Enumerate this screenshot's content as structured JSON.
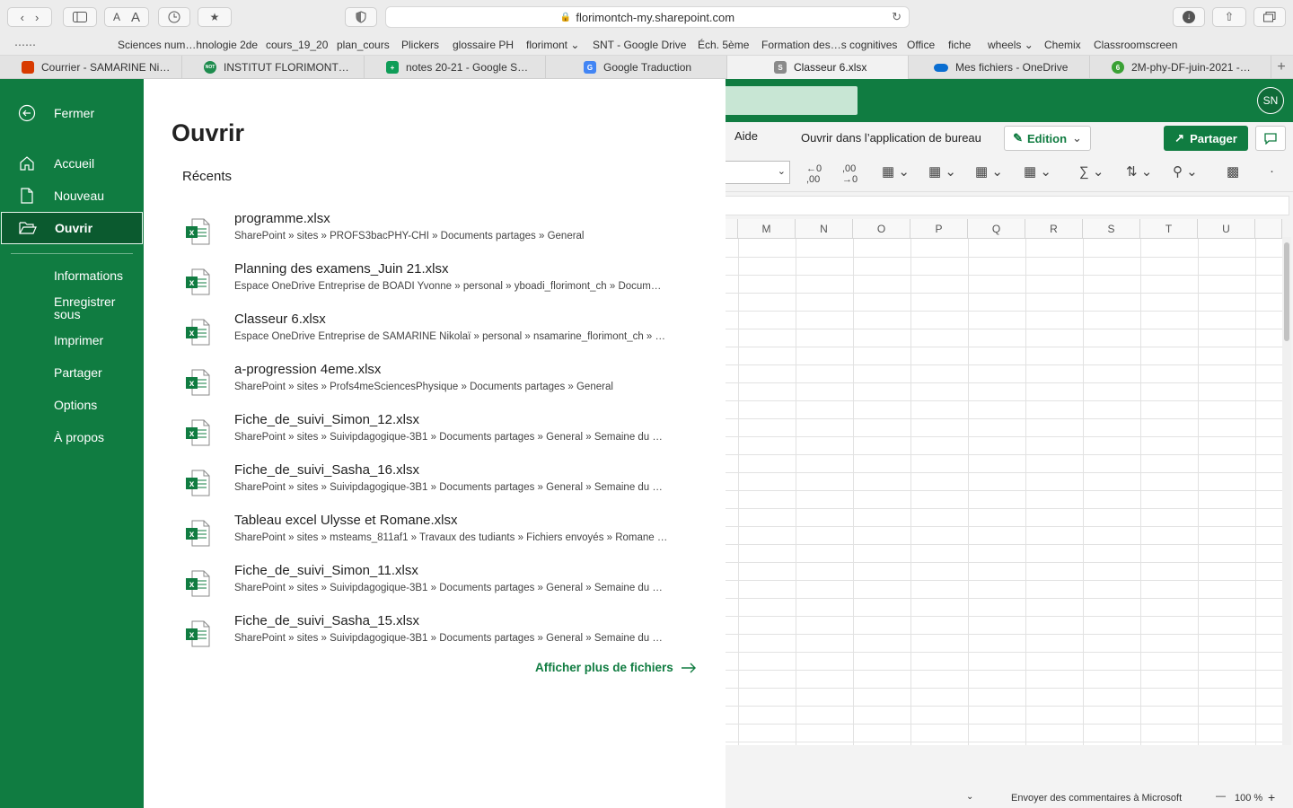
{
  "browser": {
    "url": "florimontch-my.sharepoint.com",
    "font_small": "A",
    "font_large": "A",
    "bookmarks": [
      {
        "label": "Sciences num…hnologie 2de"
      },
      {
        "label": "cours_19_20"
      },
      {
        "label": "plan_cours"
      },
      {
        "label": "Plickers"
      },
      {
        "label": "glossaire PH"
      },
      {
        "label": "florimont ⌄"
      },
      {
        "label": "SNT - Google Drive"
      },
      {
        "label": "Éch. 5ème"
      },
      {
        "label": "Formation des…s cognitives"
      },
      {
        "label": "Office"
      },
      {
        "label": "fiche"
      },
      {
        "label": "wheels ⌄"
      },
      {
        "label": "Chemix"
      },
      {
        "label": "Classroomscreen"
      }
    ],
    "tabs": [
      {
        "label": "Courrier - SAMARINE Ni…",
        "color": "#d83b01",
        "glyph": ""
      },
      {
        "label": "INSTITUT FLORIMONT…",
        "color": "#1e8c4e",
        "glyph": "NOT"
      },
      {
        "label": "notes 20-21 - Google S…",
        "color": "#0f9d58",
        "glyph": "+"
      },
      {
        "label": "Google Traduction",
        "color": "#4285f4",
        "glyph": "G"
      },
      {
        "label": "Classeur 6.xlsx",
        "color": "#8a8a8a",
        "glyph": "S"
      },
      {
        "label": "Mes fichiers - OneDrive",
        "color": "#0a6ed1",
        "glyph": ""
      },
      {
        "label": "2M-phy-DF-juin-2021 -…",
        "color": "#3aa135",
        "glyph": "6"
      }
    ]
  },
  "excel": {
    "avatar": "SN",
    "menu_aide": "Aide",
    "open_desktop": "Ouvrir dans l’application de bureau",
    "edition_label": "Edition",
    "share_label": "Partager",
    "columns": [
      "M",
      "N",
      "O",
      "P",
      "Q",
      "R",
      "S",
      "T",
      "U"
    ],
    "status_feedback": "Envoyer des commentaires à Microsoft",
    "zoom_minus": "—",
    "zoom_value": "100 %",
    "zoom_plus": "+",
    "accent": "#107c41"
  },
  "backstage": {
    "nav": {
      "close": "Fermer",
      "home": "Accueil",
      "new": "Nouveau",
      "open": "Ouvrir",
      "info": "Informations",
      "save_as_1": "Enregistrer",
      "save_as_2": "sous",
      "print": "Imprimer",
      "share": "Partager",
      "options": "Options",
      "about": "À propos"
    },
    "title": "Ouvrir",
    "recent_label": "Récents",
    "files": [
      {
        "name": "programme.xlsx",
        "path": "SharePoint » sites » PROFS3bacPHY-CHI » Documents partages » General"
      },
      {
        "name": "Planning des examens_Juin 21.xlsx",
        "path": "Espace OneDrive Entreprise de BOADI Yvonne » personal » yboadi_florimont_ch » Docum…"
      },
      {
        "name": "Classeur 6.xlsx",
        "path": "Espace OneDrive Entreprise de SAMARINE Nikolaï » personal » nsamarine_florimont_ch » …"
      },
      {
        "name": "a-progression 4eme.xlsx",
        "path": "SharePoint » sites » Profs4meSciencesPhysique » Documents partages » General"
      },
      {
        "name": "Fiche_de_suivi_Simon_12.xlsx",
        "path": "SharePoint » sites » Suivipdagogique-3B1 » Documents partages » General » Semaine du …"
      },
      {
        "name": "Fiche_de_suivi_Sasha_16.xlsx",
        "path": "SharePoint » sites » Suivipdagogique-3B1 » Documents partages » General » Semaine du …"
      },
      {
        "name": "Tableau excel Ulysse et Romane.xlsx",
        "path": "SharePoint » sites » msteams_811af1 » Travaux des tudiants » Fichiers envoyés » Romane …"
      },
      {
        "name": "Fiche_de_suivi_Simon_11.xlsx",
        "path": "SharePoint » sites » Suivipdagogique-3B1 » Documents partages » General » Semaine du …"
      },
      {
        "name": "Fiche_de_suivi_Sasha_15.xlsx",
        "path": "SharePoint » sites » Suivipdagogique-3B1 » Documents partages » General » Semaine du …"
      }
    ],
    "more_label": "Afficher plus de fichiers"
  }
}
